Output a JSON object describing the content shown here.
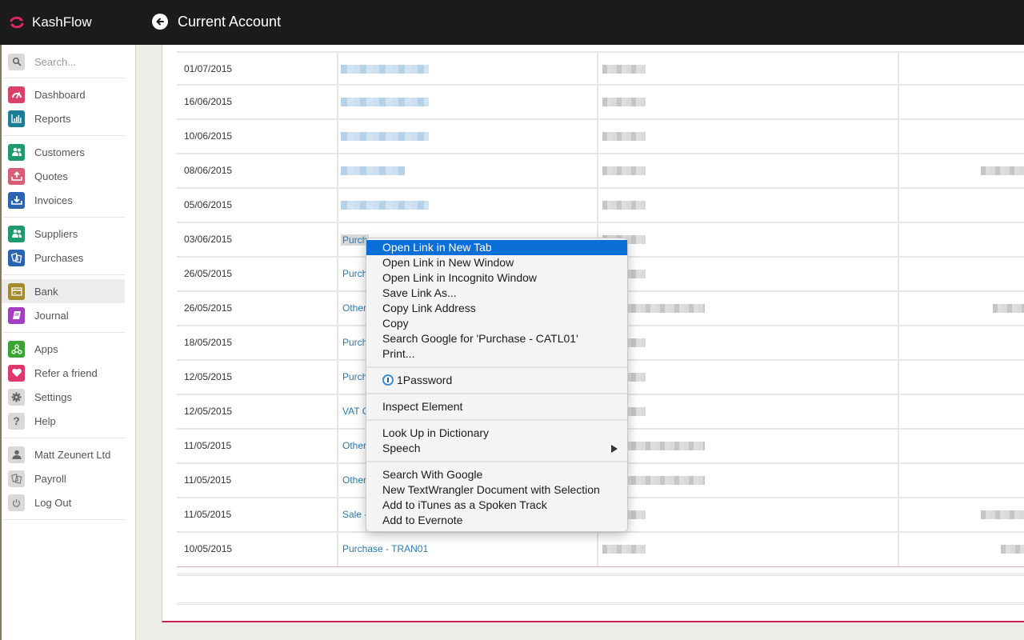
{
  "app": {
    "name": "KashFlow",
    "brand_color": "#e0246b",
    "page_title": "Current Account"
  },
  "sidebar": {
    "search_placeholder": "Search...",
    "items": [
      {
        "label": "Dashboard",
        "icon": "gauge-icon",
        "color": "#d9406a"
      },
      {
        "label": "Reports",
        "icon": "bar-chart-icon",
        "color": "#1c7e96"
      },
      {
        "label": "Customers",
        "icon": "users-icon",
        "color": "#1e9a6e"
      },
      {
        "label": "Quotes",
        "icon": "upload-tray-icon",
        "color": "#d65c78"
      },
      {
        "label": "Invoices",
        "icon": "download-tray-icon",
        "color": "#2b64b0"
      },
      {
        "label": "Suppliers",
        "icon": "users-icon",
        "color": "#1e9a6e"
      },
      {
        "label": "Purchases",
        "icon": "documents-icon",
        "color": "#2b64b0"
      },
      {
        "label": "Bank",
        "icon": "card-icon",
        "color": "#a38a2e",
        "active": true
      },
      {
        "label": "Journal",
        "icon": "book-icon",
        "color": "#a23fc0"
      },
      {
        "label": "Apps",
        "icon": "apps-network-icon",
        "color": "#3aa535"
      },
      {
        "label": "Refer a friend",
        "icon": "heart-icon",
        "color": "#e0386c"
      },
      {
        "label": "Settings",
        "icon": "gear-icon",
        "color": "#d9d9d9"
      },
      {
        "label": "Help",
        "icon": "question-icon",
        "color": "#d9d9d9"
      },
      {
        "label": "Matt Zeunert Ltd",
        "icon": "user-icon",
        "color": "#d9d9d9"
      },
      {
        "label": "Payroll",
        "icon": "documents-icon",
        "color": "#d9d9d9"
      },
      {
        "label": "Log Out",
        "icon": "power-icon",
        "color": "#d9d9d9"
      }
    ]
  },
  "table": {
    "rows": [
      {
        "date": "01/07/2015",
        "desc": ""
      },
      {
        "date": "16/06/2015",
        "desc": ""
      },
      {
        "date": "10/06/2015",
        "desc": ""
      },
      {
        "date": "08/06/2015",
        "desc": ""
      },
      {
        "date": "05/06/2015",
        "desc": ""
      },
      {
        "date": "03/06/2015",
        "desc": "Purch"
      },
      {
        "date": "26/05/2015",
        "desc": "Purch"
      },
      {
        "date": "26/05/2015",
        "desc": "Other"
      },
      {
        "date": "18/05/2015",
        "desc": "Purch"
      },
      {
        "date": "12/05/2015",
        "desc": "Purch"
      },
      {
        "date": "12/05/2015",
        "desc": "VAT C"
      },
      {
        "date": "11/05/2015",
        "desc": "Other"
      },
      {
        "date": "11/05/2015",
        "desc": "Other"
      },
      {
        "date": "11/05/2015",
        "desc": "Sale -"
      },
      {
        "date": "10/05/2015",
        "desc": "Purchase - TRAN01"
      }
    ]
  },
  "context_menu": {
    "groups": [
      [
        {
          "label": "Open Link in New Tab",
          "highlighted": true
        },
        {
          "label": "Open Link in New Window"
        },
        {
          "label": "Open Link in Incognito Window"
        },
        {
          "label": "Save Link As..."
        },
        {
          "label": "Copy Link Address"
        },
        {
          "label": "Copy"
        },
        {
          "label": "Search Google for 'Purchase - CATL01'"
        },
        {
          "label": "Print..."
        }
      ],
      [
        {
          "label": "1Password",
          "icon": "1password-icon"
        }
      ],
      [
        {
          "label": "Inspect Element"
        }
      ],
      [
        {
          "label": "Look Up in Dictionary"
        },
        {
          "label": "Speech",
          "submenu": true
        }
      ],
      [
        {
          "label": "Search With Google"
        },
        {
          "label": "New TextWrangler Document with Selection"
        },
        {
          "label": "Add to iTunes as a Spoken Track"
        },
        {
          "label": "Add to Evernote"
        }
      ]
    ]
  }
}
